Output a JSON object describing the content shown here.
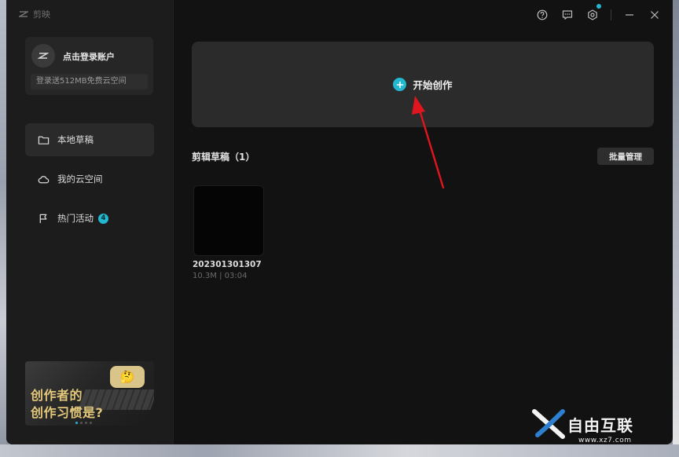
{
  "app": {
    "logo_text": "剪映"
  },
  "account": {
    "login_label": "点击登录账户",
    "promo_text": "登录送512MB免费云空间"
  },
  "sidebar": {
    "items": [
      {
        "label": "本地草稿",
        "icon": "folder-icon",
        "active": true
      },
      {
        "label": "我的云空间",
        "icon": "cloud-icon",
        "active": false
      },
      {
        "label": "热门活动",
        "icon": "flag-icon",
        "badge": "4",
        "active": false
      }
    ],
    "banner": {
      "line1": "创作者的",
      "line2": "创作习惯是?",
      "emoji": "🤔"
    }
  },
  "titlebar": {
    "icons": [
      "help-icon",
      "feedback-icon",
      "settings-icon",
      "minimize-icon",
      "close-icon"
    ]
  },
  "main": {
    "create_label": "开始创作",
    "section_title": "剪辑草稿（1）",
    "batch_label": "批量管理",
    "drafts": [
      {
        "name": "202301301307",
        "meta": "10.3M | 03:04"
      }
    ]
  },
  "watermark": {
    "text": "自由互联",
    "url": "www.xz7.com"
  },
  "colors": {
    "accent": "#22b8cf",
    "arrow": "#e0161f",
    "background": "#121212",
    "sidebar": "#1c1c1c"
  }
}
